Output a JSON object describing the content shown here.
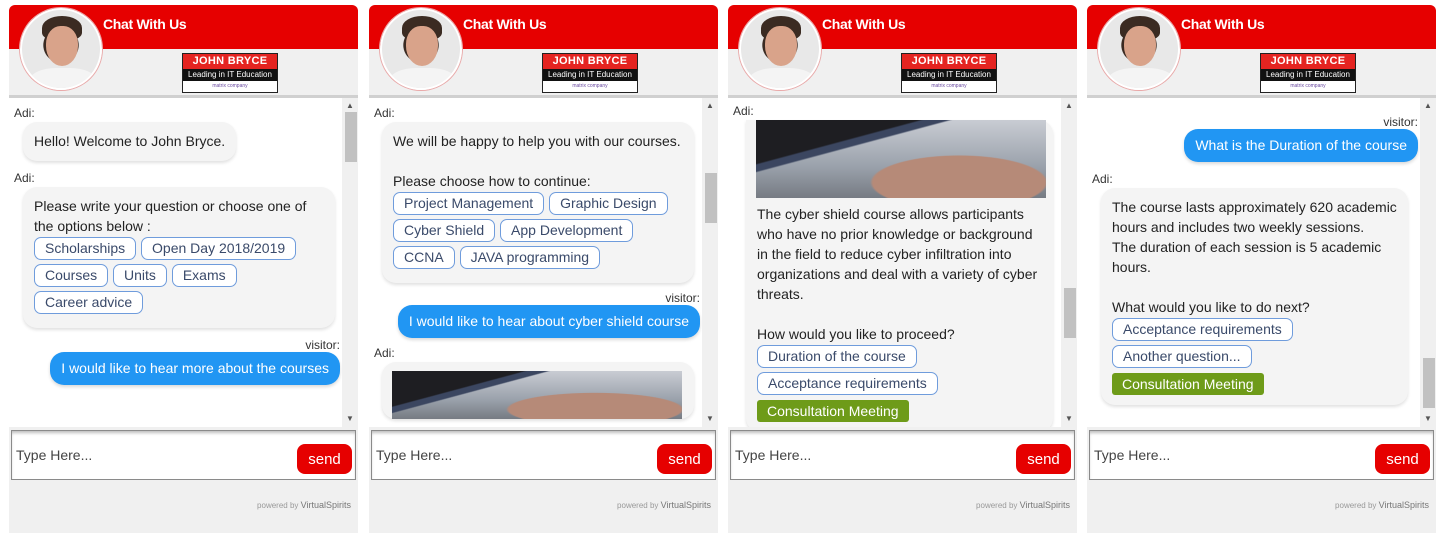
{
  "common": {
    "header_title": "Chat With Us",
    "logo_title": "JOHN BRYCE",
    "logo_tagline": "Leading in IT Education",
    "logo_footer": "matrix company",
    "input_placeholder": "Type Here...",
    "send_label": "send",
    "powered_prefix": "powered by",
    "powered_brand": "VirtualSpirits",
    "bot_name": "Adi:",
    "visitor_name": "visitor:",
    "colors": {
      "header": "#e60000",
      "visitor_bubble": "#2196f3",
      "option_border": "#6f9cdc",
      "cta_green": "#6e9b19",
      "send_button": "#e60000"
    }
  },
  "widgets": [
    {
      "scroll_position": "top",
      "messages": [
        {
          "sender": "Adi:",
          "text": "Hello! Welcome to John Bryce."
        },
        {
          "sender": "Adi:",
          "text": "Please write your question or choose one of the options below :",
          "options": [
            "Scholarships",
            "Open Day 2018/2019",
            "Courses",
            "Units",
            "Exams",
            "Career advice"
          ]
        },
        {
          "sender": "visitor:",
          "text": "I would like to hear more about the courses"
        }
      ]
    },
    {
      "scroll_position": "middle",
      "messages": [
        {
          "sender": "Adi:",
          "text_lines": [
            "We will be happy to help you with our courses.",
            "",
            "Please choose how to continue:"
          ],
          "options": [
            "Project Management",
            "Graphic Design",
            "Cyber Shield",
            "App Development",
            "CCNA",
            "JAVA programming"
          ]
        },
        {
          "sender": "visitor:",
          "text": "I would like to hear about cyber shield course"
        },
        {
          "sender": "Adi:",
          "image": "laptop-typing-image"
        }
      ]
    },
    {
      "scroll_position": "lower-middle",
      "messages": [
        {
          "sender": "Adi:",
          "image": "laptop-typing-image",
          "text": "The cyber shield course allows participants who have no prior knowledge or background in the field to reduce cyber infiltration into organizations and deal with a variety of cyber threats.",
          "prompt": "How would you like to proceed?",
          "options": [
            "Duration of the course",
            "Acceptance requirements"
          ],
          "cta": "Consultation Meeting"
        }
      ]
    },
    {
      "scroll_position": "bottom",
      "messages": [
        {
          "sender": "visitor:",
          "text": "What is the Duration of the course"
        },
        {
          "sender": "Adi:",
          "text_lines": [
            "The course lasts approximately 620 academic hours and includes two weekly sessions.",
            "The duration of each session is 5 academic hours."
          ],
          "prompt": "What would you like to do next?",
          "options": [
            "Acceptance requirements",
            "Another question..."
          ],
          "cta": "Consultation Meeting"
        }
      ]
    }
  ]
}
